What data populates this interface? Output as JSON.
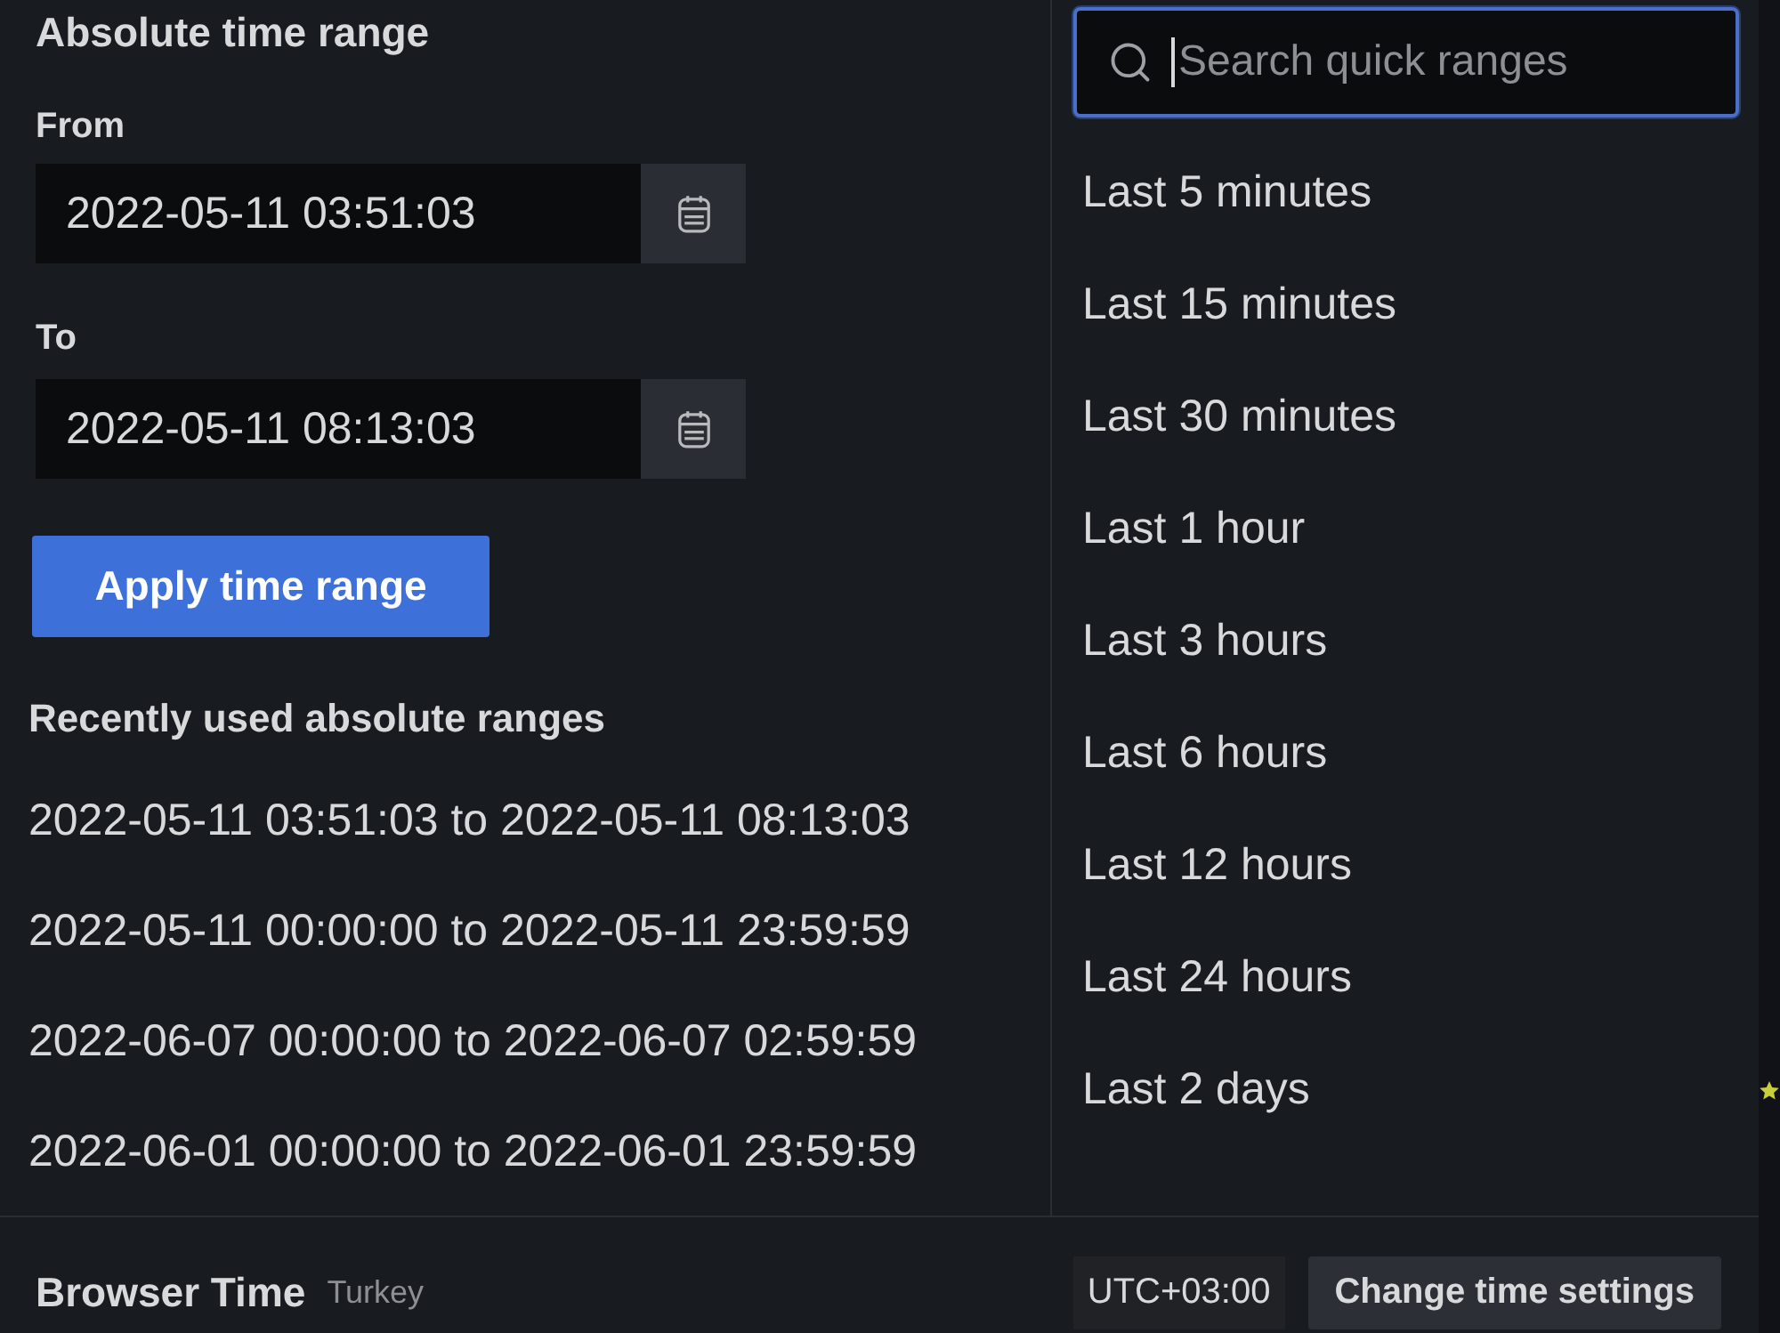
{
  "absolute_range": {
    "title": "Absolute time range",
    "fields": [
      {
        "label": "From",
        "value": "2022-05-11 03:51:03"
      },
      {
        "label": "To",
        "value": "2022-05-11 08:13:03"
      }
    ],
    "apply_button": "Apply time range"
  },
  "recent": {
    "title": "Recently used absolute ranges",
    "items": [
      "2022-05-11 03:51:03 to 2022-05-11 08:13:03",
      "2022-05-11 00:00:00 to 2022-05-11 23:59:59",
      "2022-06-07 00:00:00 to 2022-06-07 02:59:59",
      "2022-06-01 00:00:00 to 2022-06-01 23:59:59"
    ]
  },
  "quick_ranges": {
    "search": {
      "placeholder": "Search quick ranges",
      "focused": true
    },
    "items": [
      "Last 5 minutes",
      "Last 15 minutes",
      "Last 30 minutes",
      "Last 1 hour",
      "Last 3 hours",
      "Last 6 hours",
      "Last 12 hours",
      "Last 24 hours",
      "Last 2 days"
    ]
  },
  "footer": {
    "label": "Browser Time",
    "timezone": "Turkey",
    "offset": "UTC+03:00",
    "button": "Change time settings"
  }
}
